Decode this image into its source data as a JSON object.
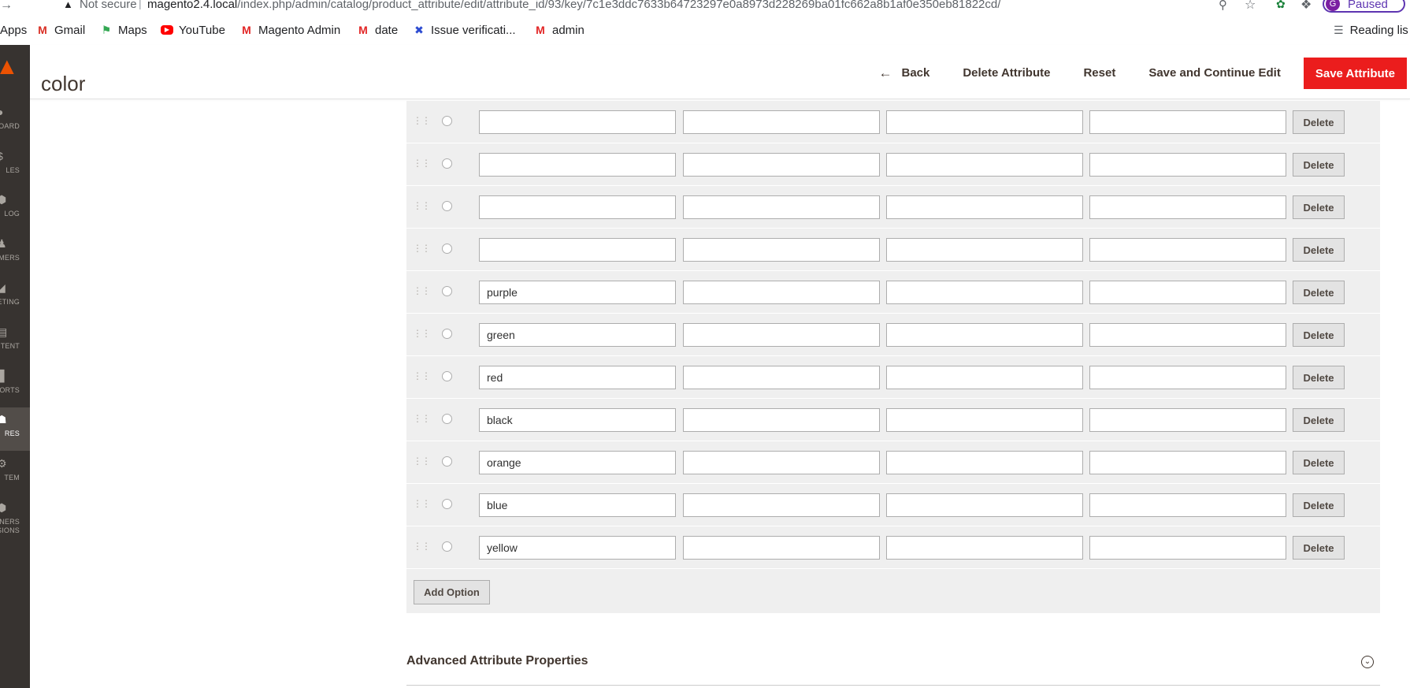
{
  "browser": {
    "security_label": "Not secure",
    "url_host": "magento2.4.local",
    "url_path": "/index.php/admin/catalog/product_attribute/edit/attribute_id/93/key/7c1e3ddc7633b64723297e0a8973d228269ba01fc662a8b1af0e350eb81822cd/",
    "profile_initial": "G",
    "profile_status": "Paused",
    "bookmarks": [
      {
        "label": "Apps",
        "icon": "apps-icon"
      },
      {
        "label": "Gmail",
        "icon": "gmail-icon"
      },
      {
        "label": "Maps",
        "icon": "maps-icon"
      },
      {
        "label": "YouTube",
        "icon": "youtube-icon"
      },
      {
        "label": "Magento Admin",
        "icon": "magento-icon"
      },
      {
        "label": "date",
        "icon": "magento-icon"
      },
      {
        "label": "Issue verificati...",
        "icon": "jira-icon"
      },
      {
        "label": "admin",
        "icon": "magento-icon"
      }
    ],
    "reading_list": "Reading lis"
  },
  "sidebar": {
    "items": [
      {
        "label": "BOARD",
        "icon": "dashboard-icon"
      },
      {
        "label": "LES",
        "icon": "sales-icon"
      },
      {
        "label": "LOG",
        "icon": "catalog-icon"
      },
      {
        "label": "OMERS",
        "icon": "customers-icon"
      },
      {
        "label": "ETING",
        "icon": "marketing-icon"
      },
      {
        "label": "TENT",
        "icon": "content-icon"
      },
      {
        "label": "ORTS",
        "icon": "reports-icon"
      },
      {
        "label": "RES",
        "icon": "stores-icon",
        "active": true
      },
      {
        "label": "TEM",
        "icon": "system-icon"
      },
      {
        "label": "RTNERS",
        "label2": "NSIONS",
        "icon": "partners-icon"
      }
    ]
  },
  "header": {
    "title": "color",
    "back_label": "Back",
    "delete_label": "Delete Attribute",
    "reset_label": "Reset",
    "save_continue_label": "Save and Continue Edit",
    "save_label": "Save Attribute"
  },
  "options": {
    "rows": [
      {
        "admin_value": ""
      },
      {
        "admin_value": ""
      },
      {
        "admin_value": ""
      },
      {
        "admin_value": ""
      },
      {
        "admin_value": "purple"
      },
      {
        "admin_value": "green"
      },
      {
        "admin_value": "red"
      },
      {
        "admin_value": "black"
      },
      {
        "admin_value": "orange"
      },
      {
        "admin_value": "blue"
      },
      {
        "admin_value": "yellow"
      }
    ],
    "delete_label": "Delete",
    "add_option_label": "Add Option"
  },
  "advanced": {
    "title": "Advanced Attribute Properties"
  },
  "colors": {
    "accent": "#eb1d1d",
    "sidebar_bg": "#373330",
    "panel_bg": "#efefef"
  }
}
